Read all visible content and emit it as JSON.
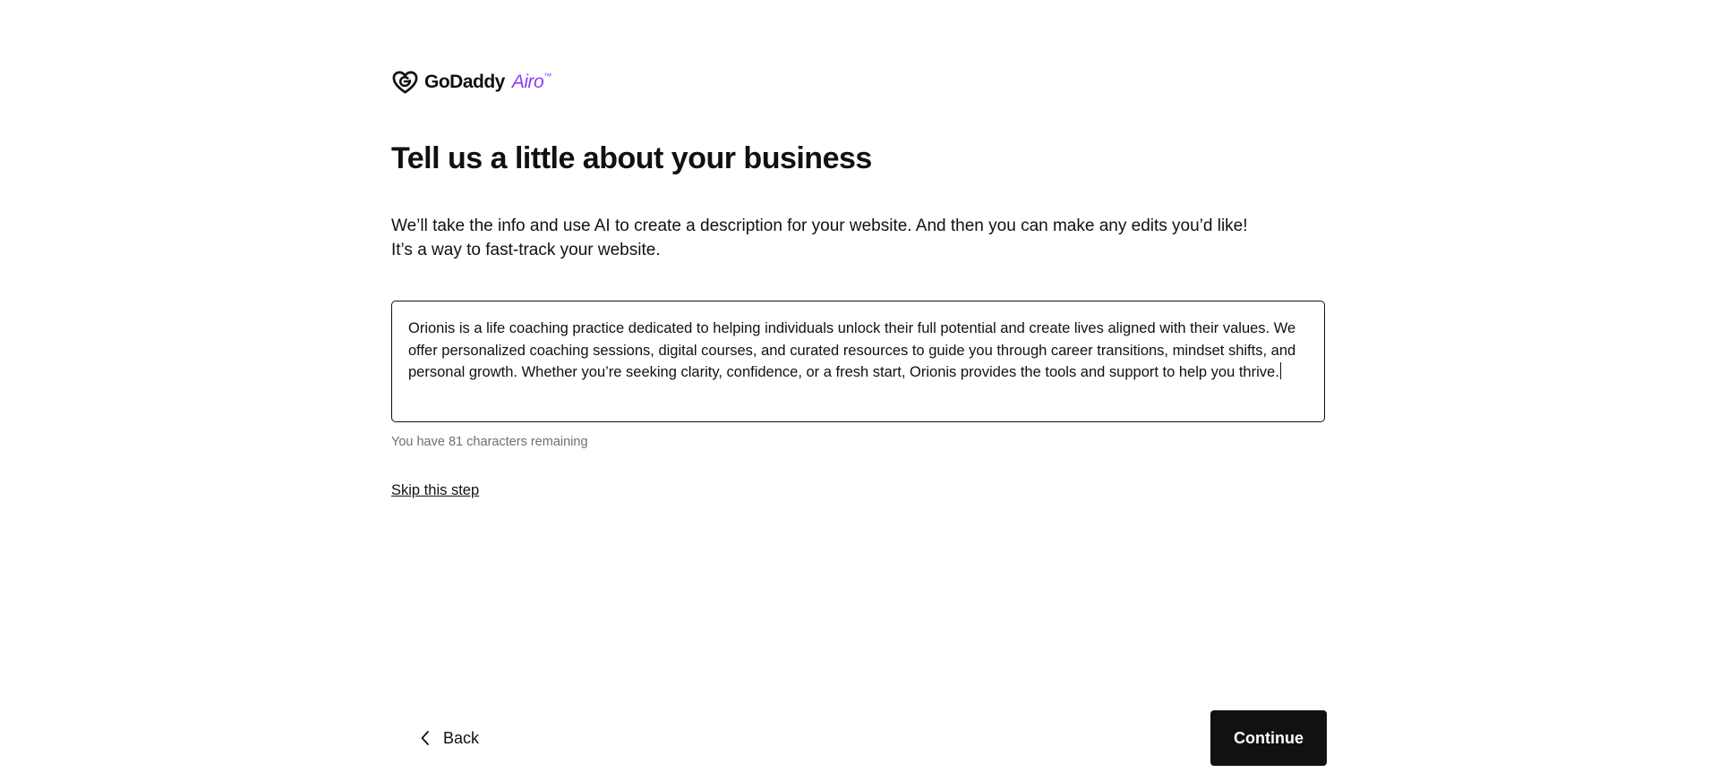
{
  "brand": {
    "logo_icon": "godaddy-g-heart-icon",
    "name": "GoDaddy",
    "product": "Airo",
    "trademark": "™",
    "product_color": "#8a3dff"
  },
  "page": {
    "title": "Tell us a little about your business",
    "intro_line1": "We’ll take the info and use AI to create a description for your website. And then you can make any edits you’d like!",
    "intro_line2": "It’s a way to fast-track your website."
  },
  "description": {
    "value": "Orionis is a life coaching practice dedicated to helping individuals unlock their full potential and create lives aligned with their values. We offer personalized coaching sessions, digital courses, and curated resources to guide you through career transitions, mindset shifts, and personal growth. Whether you’re seeking clarity, confidence, or a fresh start, Orionis provides the tools and support to help you thrive.",
    "chars_remaining": "You have 81 characters remaining"
  },
  "actions": {
    "skip_label": "Skip this step",
    "back_label": "Back",
    "back_icon": "chevron-left-icon",
    "continue_label": "Continue"
  },
  "colors": {
    "text": "#111111",
    "muted": "#6f6f6f",
    "button_bg": "#111111",
    "button_text": "#ffffff",
    "background": "#ffffff"
  }
}
